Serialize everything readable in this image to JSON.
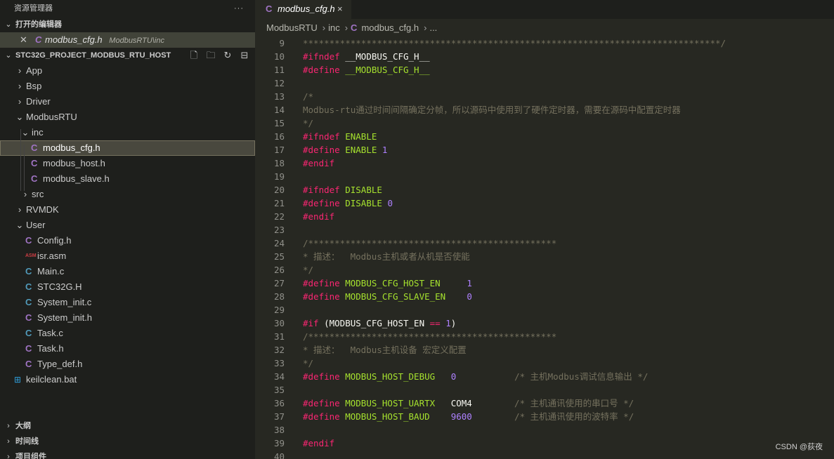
{
  "sidebar": {
    "title": "资源管理器",
    "more_icon": "···",
    "open_editors": {
      "label": "打开的编辑器",
      "items": [
        {
          "name": "modbus_cfg.h",
          "path": "ModbusRTU\\inc"
        }
      ]
    },
    "project": {
      "label": "STC32G_PROJECT_MODBUS_RTU_HOST",
      "actions": [
        "new-file-icon",
        "new-folder-icon",
        "refresh-icon",
        "collapse-all-icon"
      ]
    },
    "tree": [
      {
        "label": "App",
        "type": "folder",
        "depth": 0,
        "expanded": false
      },
      {
        "label": "Bsp",
        "type": "folder",
        "depth": 0,
        "expanded": false
      },
      {
        "label": "Driver",
        "type": "folder",
        "depth": 0,
        "expanded": false
      },
      {
        "label": "ModbusRTU",
        "type": "folder",
        "depth": 0,
        "expanded": true
      },
      {
        "label": "inc",
        "type": "folder",
        "depth": 1,
        "expanded": true
      },
      {
        "label": "modbus_cfg.h",
        "type": "h",
        "depth": 2,
        "selected": true
      },
      {
        "label": "modbus_host.h",
        "type": "h",
        "depth": 2
      },
      {
        "label": "modbus_slave.h",
        "type": "h",
        "depth": 2
      },
      {
        "label": "src",
        "type": "folder",
        "depth": 1,
        "expanded": false
      },
      {
        "label": "RVMDK",
        "type": "folder",
        "depth": 0,
        "expanded": false
      },
      {
        "label": "User",
        "type": "folder",
        "depth": 0,
        "expanded": true
      },
      {
        "label": "Config.h",
        "type": "h",
        "depth": 1
      },
      {
        "label": "isr.asm",
        "type": "asm",
        "depth": 1
      },
      {
        "label": "Main.c",
        "type": "c",
        "depth": 1
      },
      {
        "label": "STC32G.H",
        "type": "c",
        "depth": 1
      },
      {
        "label": "System_init.c",
        "type": "c",
        "depth": 1
      },
      {
        "label": "System_init.h",
        "type": "h",
        "depth": 1
      },
      {
        "label": "Task.c",
        "type": "c",
        "depth": 1
      },
      {
        "label": "Task.h",
        "type": "h",
        "depth": 1
      },
      {
        "label": "Type_def.h",
        "type": "h",
        "depth": 1
      },
      {
        "label": "keilclean.bat",
        "type": "bat",
        "depth": 0
      }
    ],
    "bottom_sections": [
      "大纲",
      "时间线",
      "项目组件"
    ]
  },
  "tab": {
    "name": "modbus_cfg.h",
    "close": "×"
  },
  "breadcrumb": [
    "ModbusRTU",
    "inc",
    "modbus_cfg.h",
    "..."
  ],
  "code_lines": [
    {
      "n": "9",
      "tokens": [
        [
          "cm",
          "*******************************************************************************/"
        ]
      ]
    },
    {
      "n": "10",
      "tokens": [
        [
          "kw",
          "#ifndef"
        ],
        [
          "plain",
          " __MODBUS_CFG_H__"
        ]
      ]
    },
    {
      "n": "11",
      "tokens": [
        [
          "kw",
          "#define"
        ],
        [
          "plain",
          " "
        ],
        [
          "mac",
          "__MODBUS_CFG_H__"
        ]
      ]
    },
    {
      "n": "12",
      "tokens": []
    },
    {
      "n": "13",
      "tokens": [
        [
          "cm",
          "/*"
        ]
      ]
    },
    {
      "n": "14",
      "tokens": [
        [
          "cm",
          "Modbus-rtu通过时间间隔确定分帧，所以源码中使用到了硬件定时器，需要在源码中配置定时器"
        ]
      ]
    },
    {
      "n": "15",
      "tokens": [
        [
          "cm",
          "*/"
        ]
      ]
    },
    {
      "n": "16",
      "tokens": [
        [
          "kw",
          "#ifndef"
        ],
        [
          "mac",
          " ENABLE"
        ]
      ]
    },
    {
      "n": "17",
      "tokens": [
        [
          "kw",
          "#define"
        ],
        [
          "mac",
          " ENABLE"
        ],
        [
          "plain",
          " "
        ],
        [
          "num",
          "1"
        ]
      ]
    },
    {
      "n": "18",
      "tokens": [
        [
          "kw",
          "#endif"
        ]
      ]
    },
    {
      "n": "19",
      "tokens": []
    },
    {
      "n": "20",
      "tokens": [
        [
          "kw",
          "#ifndef"
        ],
        [
          "mac",
          " DISABLE"
        ]
      ]
    },
    {
      "n": "21",
      "tokens": [
        [
          "kw",
          "#define"
        ],
        [
          "mac",
          " DISABLE"
        ],
        [
          "plain",
          " "
        ],
        [
          "num",
          "0"
        ]
      ]
    },
    {
      "n": "22",
      "tokens": [
        [
          "kw",
          "#endif"
        ]
      ]
    },
    {
      "n": "23",
      "tokens": []
    },
    {
      "n": "24",
      "tokens": [
        [
          "cm",
          "/***********************************************"
        ]
      ]
    },
    {
      "n": "25",
      "tokens": [
        [
          "cm",
          "* 描述：  Modbus主机或者从机是否使能"
        ]
      ]
    },
    {
      "n": "26",
      "tokens": [
        [
          "cm",
          "*/"
        ]
      ]
    },
    {
      "n": "27",
      "tokens": [
        [
          "kw",
          "#define"
        ],
        [
          "mac",
          " MODBUS_CFG_HOST_EN"
        ],
        [
          "plain",
          "     "
        ],
        [
          "num",
          "1"
        ]
      ]
    },
    {
      "n": "28",
      "tokens": [
        [
          "kw",
          "#define"
        ],
        [
          "mac",
          " MODBUS_CFG_SLAVE_EN"
        ],
        [
          "plain",
          "    "
        ],
        [
          "num",
          "0"
        ]
      ]
    },
    {
      "n": "29",
      "tokens": []
    },
    {
      "n": "30",
      "tokens": [
        [
          "kw",
          "#if"
        ],
        [
          "plain",
          " (MODBUS_CFG_HOST_EN "
        ],
        [
          "kw",
          "=="
        ],
        [
          "plain",
          " "
        ],
        [
          "num",
          "1"
        ],
        [
          "plain",
          ")"
        ]
      ]
    },
    {
      "n": "31",
      "tokens": [
        [
          "cm",
          "/***********************************************"
        ]
      ]
    },
    {
      "n": "32",
      "tokens": [
        [
          "cm",
          "* 描述：  Modbus主机设备 宏定义配置"
        ]
      ]
    },
    {
      "n": "33",
      "tokens": [
        [
          "cm",
          "*/"
        ]
      ]
    },
    {
      "n": "34",
      "tokens": [
        [
          "kw",
          "#define"
        ],
        [
          "mac",
          " MODBUS_HOST_DEBUG"
        ],
        [
          "plain",
          "   "
        ],
        [
          "num",
          "0"
        ],
        [
          "plain",
          "           "
        ],
        [
          "cm",
          "/* 主机Modbus调试信息输出 */"
        ]
      ]
    },
    {
      "n": "35",
      "tokens": []
    },
    {
      "n": "36",
      "tokens": [
        [
          "kw",
          "#define"
        ],
        [
          "mac",
          " MODBUS_HOST_UARTX"
        ],
        [
          "plain",
          "   COM4        "
        ],
        [
          "cm",
          "/* 主机通讯使用的串口号 */"
        ]
      ]
    },
    {
      "n": "37",
      "tokens": [
        [
          "kw",
          "#define"
        ],
        [
          "mac",
          " MODBUS_HOST_BAUD"
        ],
        [
          "plain",
          "    "
        ],
        [
          "num",
          "9600"
        ],
        [
          "plain",
          "        "
        ],
        [
          "cm",
          "/* 主机通讯使用的波特率 */"
        ]
      ]
    },
    {
      "n": "38",
      "tokens": []
    },
    {
      "n": "39",
      "tokens": [
        [
          "kw",
          "#endif"
        ]
      ]
    },
    {
      "n": "40",
      "tokens": []
    }
  ],
  "watermark": "CSDN @荻夜"
}
